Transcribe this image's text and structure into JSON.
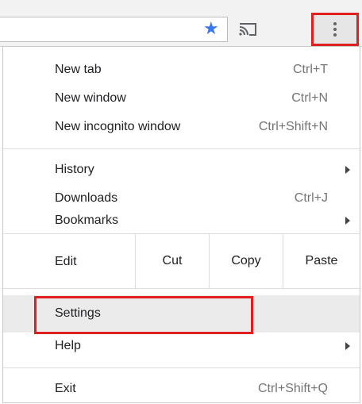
{
  "toolbar": {
    "star_icon": "star-icon",
    "cast_icon": "cast-icon",
    "menu_icon": "kebab-menu-icon"
  },
  "menu": {
    "new_tab": {
      "label": "New tab",
      "shortcut": "Ctrl+T"
    },
    "new_window": {
      "label": "New window",
      "shortcut": "Ctrl+N"
    },
    "new_incognito": {
      "label": "New incognito window",
      "shortcut": "Ctrl+Shift+N"
    },
    "history": {
      "label": "History"
    },
    "downloads": {
      "label": "Downloads",
      "shortcut": "Ctrl+J"
    },
    "bookmarks": {
      "label": "Bookmarks"
    },
    "edit": {
      "label": "Edit",
      "cut": "Cut",
      "copy": "Copy",
      "paste": "Paste"
    },
    "settings": {
      "label": "Settings"
    },
    "help": {
      "label": "Help"
    },
    "exit": {
      "label": "Exit",
      "shortcut": "Ctrl+Shift+Q"
    }
  },
  "colors": {
    "highlight_border": "#e02020",
    "star": "#3b78e7",
    "hover_bg": "#ebebeb"
  }
}
